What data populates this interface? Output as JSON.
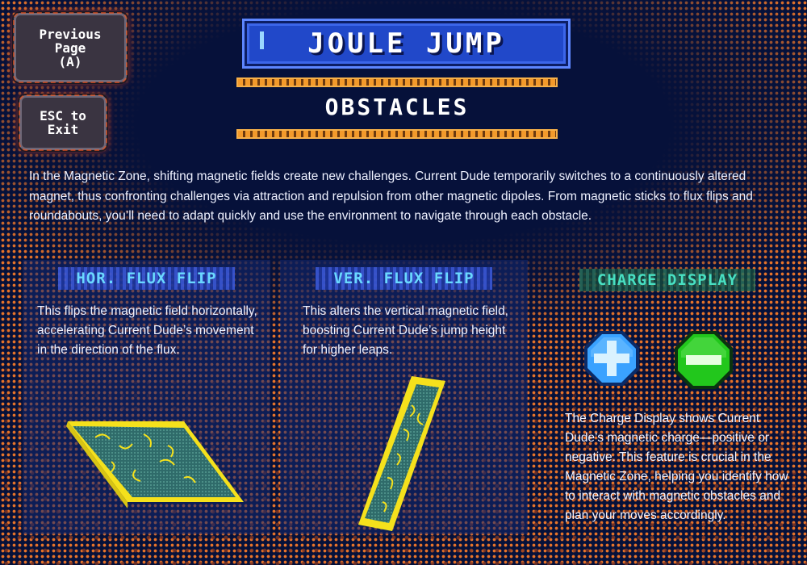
{
  "nav": {
    "previous_label": "Previous\nPage\n(A)",
    "exit_label": "ESC to\nExit"
  },
  "header": {
    "title": "JOULE JUMP",
    "subtitle": "OBSTACLES"
  },
  "intro": "In the Magnetic Zone, shifting magnetic fields create new challenges. Current Dude temporarily switches to a continuously altered magnet, thus confronting challenges via attraction and repulsion from other magnetic dipoles. From magnetic sticks to flux flips and roundabouts, you’ll need to adapt quickly and use the environment to navigate through each obstacle.",
  "cards": [
    {
      "title": "HOR. FLUX FLIP",
      "text": "This flips the magnetic field horizontally, accelerating Current Dude’s movement in the direction of the flux."
    },
    {
      "title": "VER. FLUX FLIP",
      "text": "This alters the vertical magnetic field, boosting Current Dude’s jump height for higher leaps."
    },
    {
      "title": "CHARGE DISPLAY",
      "text": "The Charge Display shows Current Dude’s magnetic charge—positive or negative. This feature is crucial in the Magnetic Zone, helping you identify how to interact with magnetic obstacles and plan your moves accordingly."
    }
  ],
  "icons": {
    "positive": "plus-charge-icon",
    "negative": "minus-charge-icon"
  },
  "colors": {
    "background": "#06113a",
    "title_bar": "#2148c9",
    "accent_orange": "#e8742a",
    "card_title_blue": "#6ad8ff",
    "card_title_teal": "#48e0c2",
    "positive": "#3aa2ff",
    "negative": "#22c71c",
    "flux_edge": "#f5e11c"
  }
}
